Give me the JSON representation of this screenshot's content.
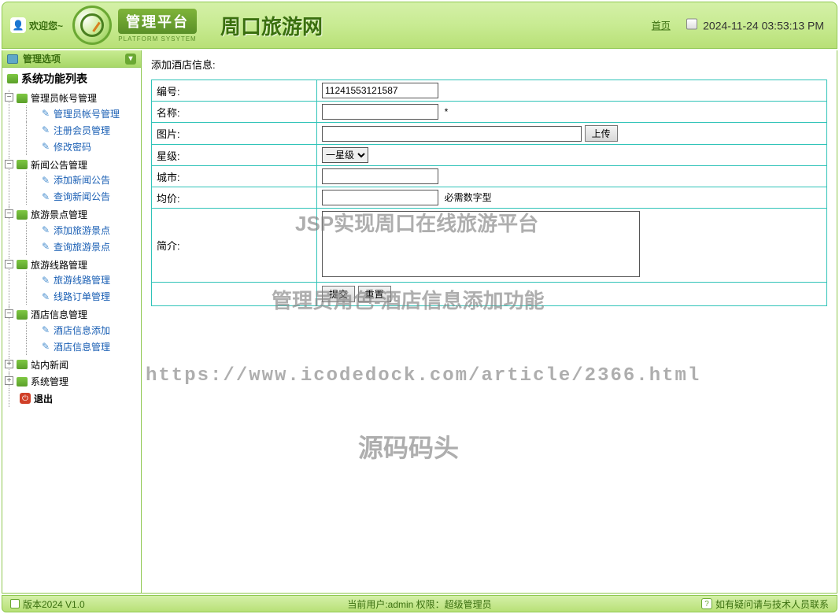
{
  "header": {
    "welcome": "欢迎您~",
    "platform_badge": "管理平台",
    "platform_sub": "PLATFORM SYSYTEM",
    "site_title": "周口旅游网",
    "home_link": "首页",
    "datetime": "2024-11-24 03:53:13 PM"
  },
  "sidebar": {
    "header": "管理选项",
    "root_title": "系统功能列表",
    "groups": [
      {
        "label": "管理员帐号管理",
        "expanded": true,
        "items": [
          "管理员帐号管理",
          "注册会员管理",
          "修改密码"
        ]
      },
      {
        "label": "新闻公告管理",
        "expanded": true,
        "items": [
          "添加新闻公告",
          "查询新闻公告"
        ]
      },
      {
        "label": "旅游景点管理",
        "expanded": true,
        "items": [
          "添加旅游景点",
          "查询旅游景点"
        ]
      },
      {
        "label": "旅游线路管理",
        "expanded": true,
        "items": [
          "旅游线路管理",
          "线路订单管理"
        ]
      },
      {
        "label": "酒店信息管理",
        "expanded": true,
        "items": [
          "酒店信息添加",
          "酒店信息管理"
        ]
      },
      {
        "label": "站内新闻",
        "expanded": false,
        "items": []
      },
      {
        "label": "系统管理",
        "expanded": false,
        "items": []
      }
    ],
    "exit_label": "退出"
  },
  "main": {
    "heading": "添加酒店信息:",
    "fields": {
      "id_label": "编号:",
      "id_value": "11241553121587",
      "name_label": "名称:",
      "name_value": "",
      "name_required": "*",
      "image_label": "图片:",
      "image_value": "",
      "upload_btn": "上传",
      "star_label": "星级:",
      "star_selected": "一星级",
      "city_label": "城市:",
      "city_value": "",
      "price_label": "均价:",
      "price_value": "",
      "price_hint": "必需数字型",
      "desc_label": "简介:",
      "desc_value": ""
    },
    "submit_btn": "提交",
    "reset_btn": "重置"
  },
  "watermarks": {
    "w1": "JSP实现周口在线旅游平台",
    "w2": "管理员角色-酒店信息添加功能",
    "w3": "https://www.icodedock.com/article/2366.html",
    "w4": "源码码头"
  },
  "footer": {
    "version": "版本2024 V1.0",
    "user_info": "当前用户:admin 权限：超级管理员",
    "contact": "如有疑问请与技术人员联系"
  }
}
